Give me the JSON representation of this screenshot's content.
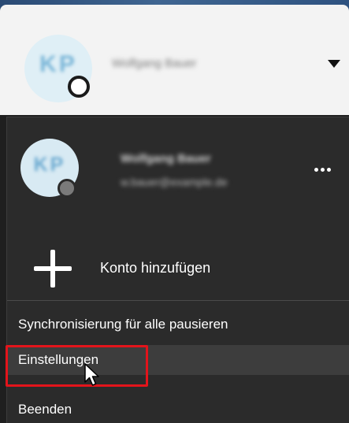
{
  "header": {
    "avatar_initials": "KP",
    "account_name": "Wolfgang Bauer",
    "dropdown_icon": "caret-down-icon"
  },
  "account": {
    "avatar_initials": "KP",
    "name": "Wolfgang Bauer",
    "email": "w.bauer@example.de",
    "more_icon": "more-dots-icon"
  },
  "menu": {
    "add_account_label": "Konto hinzufügen",
    "pause_sync_label": "Synchronisierung für alle pausieren",
    "settings_label": "Einstellungen",
    "quit_label": "Beenden"
  },
  "colors": {
    "highlight": "#e3141b",
    "menu_background": "#2b2b2b",
    "header_background": "#f3f3f3"
  }
}
